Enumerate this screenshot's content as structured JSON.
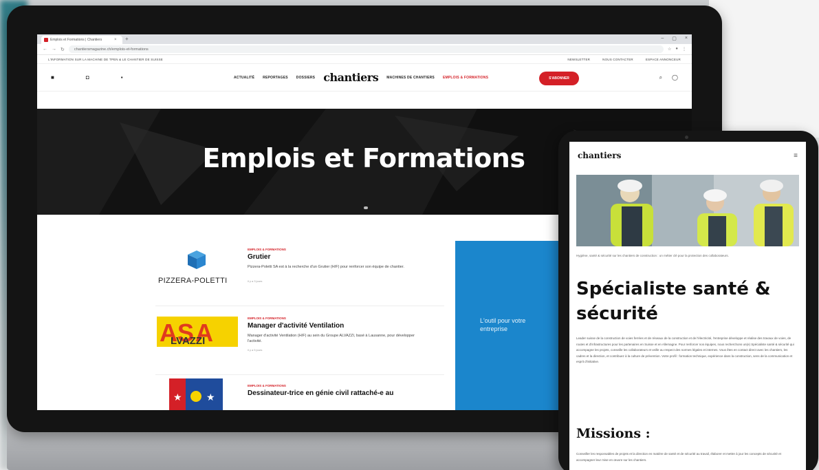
{
  "browser": {
    "tab_title": "Emplois et Formations | Chantiers",
    "url": "chantiersmagazine.ch/emplois-et-formations"
  },
  "site": {
    "top_strip_left": "L'INFORMATION SUR LA MACHINE DE TPEN & LE CHANTIER DE SUISSE",
    "top_strip_right": [
      "NEWSLETTER",
      "NOUS CONTACTER",
      "ESPACE ANNONCEUR"
    ],
    "nav_left": [
      "ACTUALITÉ",
      "REPORTAGES",
      "DOSSIERS"
    ],
    "logo": "chantiers",
    "nav_right": [
      "MACHINES DE CHANTIERS"
    ],
    "nav_highlight": "EMPLOIS & FORMATIONS",
    "subscribe_label": "S'ABONNER"
  },
  "hero": {
    "title": "Emplois et Formations"
  },
  "jobs": [
    {
      "company": "PIZZERA-POLETTI",
      "category": "EMPLOIS & FORMATIONS",
      "title": "Grutier",
      "desc": "Pizzera-Poletti SA est à la recherche d'un Grutier (H/F) pour renforcer son équipe de chantier.",
      "date": "il y a 3 jours"
    },
    {
      "company": "ASA ALVAZZI",
      "category": "EMPLOIS & FORMATIONS",
      "title": "Manager d'activité Ventilation",
      "desc": "Manager d'activité Ventilation (H/F) au sein du Groupe ALVAZZI, basé à Lausanne, pour développer l'activité.",
      "date": "il y a 5 jours"
    },
    {
      "company": "",
      "category": "EMPLOIS & FORMATIONS",
      "title": "Dessinateur-trice en génie civil rattaché-e au",
      "desc": "",
      "date": ""
    }
  ],
  "promo": {
    "text": "L'outil pour votre entreprise"
  },
  "tablet": {
    "logo": "chantiers",
    "caption": "Hygiène, santé & sécurité sur les chantiers de construction : un métier clé pour la protection des collaborateurs.",
    "title": "Spécialiste santé & sécurité",
    "body": "Leader suisse de la construction de voies ferrées et de réseaux de la construction et de l'électricité, l'entreprise développe et réalise des travaux de voies, de routes et d'infrastructures pour les partenaires en Suisse et en Allemagne. Pour renforcer nos équipes, nous recherchons un(e) Spécialiste santé & sécurité qui accompagne les projets, conseille les collaborateurs et veille au respect des normes légales et internes. Vous êtes en contact direct avec les chantiers, les cadres et la direction, et contribuez à la culture de prévention. Votre profil : formation technique, expérience dans la construction, sens de la communication et esprit d'initiative.",
    "missions_heading": "Missions :",
    "bullet": "Conseiller les responsables de projets et la direction en matière de santé et de sécurité au travail, élaborer et mettre à jour les concepts de sécurité et accompagner leur mise en œuvre sur les chantiers."
  },
  "colors": {
    "brand_red": "#d42027",
    "promo_blue": "#1b86cc"
  }
}
